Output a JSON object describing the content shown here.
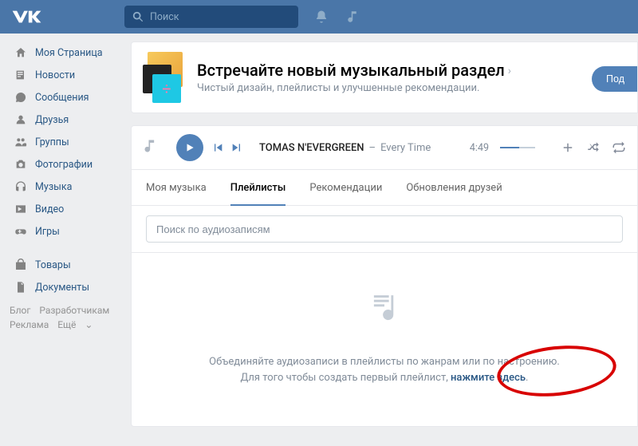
{
  "search_placeholder": "Поиск",
  "sidebar": {
    "items": [
      {
        "label": "Моя Страница"
      },
      {
        "label": "Новости"
      },
      {
        "label": "Сообщения"
      },
      {
        "label": "Друзья"
      },
      {
        "label": "Группы"
      },
      {
        "label": "Фотографии"
      },
      {
        "label": "Музыка"
      },
      {
        "label": "Видео"
      },
      {
        "label": "Игры"
      }
    ],
    "items2": [
      {
        "label": "Товары"
      },
      {
        "label": "Документы"
      }
    ]
  },
  "footer": {
    "blog": "Блог",
    "dev": "Разработчикам",
    "ads": "Реклама",
    "more": "Ещё"
  },
  "banner": {
    "title": "Встречайте новый музыкальный раздел",
    "subtitle": "Чистый дизайн, плейлисты и улучшенные рекомендации.",
    "cta": "Под"
  },
  "player": {
    "artist": "TOMAS N'EVERGREEN",
    "dash": "–",
    "song": "Every Time",
    "duration": "4:49"
  },
  "tabs": {
    "t0": "Моя музыка",
    "t1": "Плейлисты",
    "t2": "Рекомендации",
    "t3": "Обновления друзей"
  },
  "audiosearch_placeholder": "Поиск по аудиозаписям",
  "empty": {
    "line1": "Объединяйте аудиозаписи в плейлисты по жанрам или по настроению.",
    "line2_pref": "Для того чтобы создать первый плейлист, ",
    "line2_link": "нажмите здесь",
    "line2_suf": "."
  }
}
